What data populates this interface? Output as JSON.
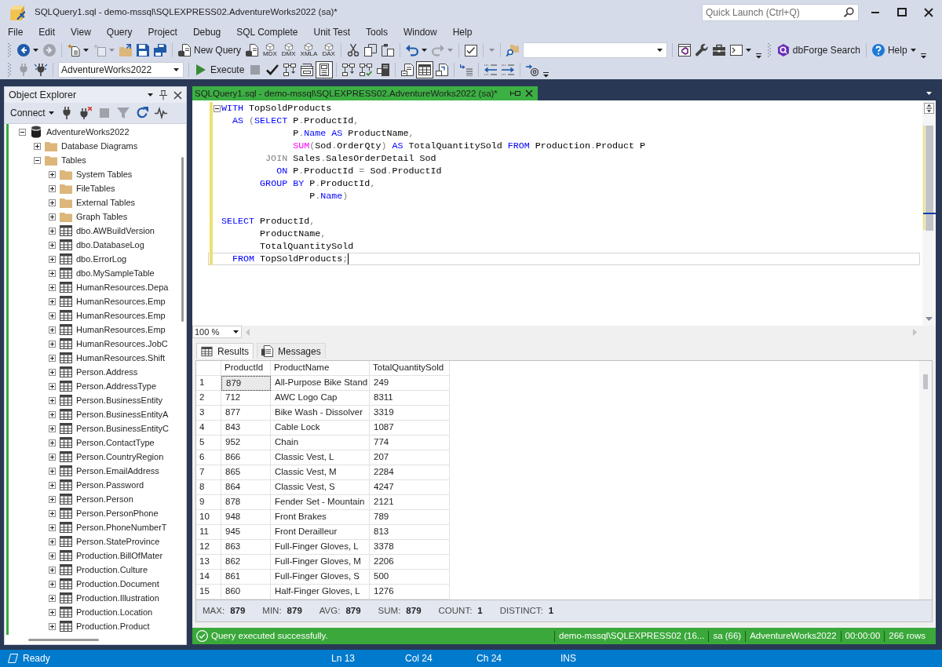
{
  "window": {
    "title": "SQLQuery1.sql - demo-mssql\\SQLEXPRESS02.AdventureWorks2022 (sa)*"
  },
  "quick_launch": {
    "placeholder": "Quick Launch (Ctrl+Q)"
  },
  "menu": [
    "File",
    "Edit",
    "View",
    "Query",
    "Project",
    "Debug",
    "SQL Complete",
    "Unit Test",
    "Tools",
    "Window",
    "Help"
  ],
  "standard_toolbar": {
    "buttons": [
      {
        "disabled": false
      },
      {
        "disabled": true
      },
      {
        "disabled": false
      },
      {
        "disabled": true
      },
      {
        "disabled": false
      },
      {
        "disabled": false
      },
      {
        "disabled": false
      },
      {
        "label": "New Query",
        "disabled": false
      },
      {
        "disabled": false
      },
      {
        "caption": "MDX",
        "disabled": false
      },
      {
        "caption": "DMX",
        "disabled": false
      },
      {
        "caption": "XMLA",
        "disabled": false
      },
      {
        "caption": "DAX",
        "disabled": false
      },
      {
        "disabled": false
      },
      {
        "disabled": false
      },
      {
        "disabled": false
      },
      {
        "disabled": false
      },
      {
        "disabled": true
      },
      {
        "disabled": false
      },
      {
        "disabled": true
      },
      {
        "disabled": false
      },
      {
        "disabled": false
      },
      {
        "disabled": false
      },
      {
        "disabled": false
      },
      {
        "disabled": false
      },
      {
        "label": "dbForge Search",
        "disabled": false
      },
      {
        "label": "Help",
        "disabled": false
      }
    ]
  },
  "sql_toolbar": {
    "database": "AdventureWorks2022",
    "buttons": [
      {
        "disabled": true
      },
      {
        "disabled": false
      },
      {
        "label": "Execute",
        "disabled": false
      },
      {
        "disabled": true
      },
      {
        "disabled": false
      },
      {
        "disabled": false
      },
      {
        "disabled": false
      },
      {
        "disabled": false,
        "on": true
      },
      {
        "disabled": false
      },
      {
        "disabled": false
      },
      {
        "disabled": false
      },
      {
        "disabled": false,
        "on": false
      },
      {
        "disabled": false,
        "on": true
      },
      {
        "disabled": false,
        "on": false
      },
      {
        "disabled": false
      },
      {
        "disabled": false
      },
      {
        "disabled": false
      },
      {
        "disabled": false
      }
    ]
  },
  "object_explorer": {
    "title": "Object Explorer",
    "toolbar": [
      {
        "label": "Connect",
        "disabled": false
      },
      {
        "disabled": false
      },
      {
        "disabled": false
      },
      {
        "disabled": true
      },
      {
        "disabled": true
      },
      {
        "disabled": false
      },
      {
        "disabled": false
      }
    ],
    "tree": [
      {
        "label": "AdventureWorks2022",
        "kind": "database",
        "expanded": true,
        "children": [
          {
            "label": "Database Diagrams",
            "kind": "folder",
            "expanded": false
          },
          {
            "label": "Tables",
            "kind": "folder",
            "expanded": true,
            "children": [
              {
                "label": "System Tables",
                "kind": "folder",
                "expanded": false
              },
              {
                "label": "FileTables",
                "kind": "folder",
                "expanded": false
              },
              {
                "label": "External Tables",
                "kind": "folder",
                "expanded": false
              },
              {
                "label": "Graph Tables",
                "kind": "folder",
                "expanded": false
              },
              {
                "label": "dbo.AWBuildVersion",
                "kind": "table",
                "expanded": false
              },
              {
                "label": "dbo.DatabaseLog",
                "kind": "table",
                "expanded": false
              },
              {
                "label": "dbo.ErrorLog",
                "kind": "table",
                "expanded": false
              },
              {
                "label": "dbo.MySampleTable",
                "kind": "table",
                "expanded": false
              },
              {
                "label": "HumanResources.Depa",
                "kind": "table",
                "expanded": false
              },
              {
                "label": "HumanResources.Emp",
                "kind": "table",
                "expanded": false
              },
              {
                "label": "HumanResources.Emp",
                "kind": "table",
                "expanded": false
              },
              {
                "label": "HumanResources.Emp",
                "kind": "table",
                "expanded": false
              },
              {
                "label": "HumanResources.JobC",
                "kind": "table",
                "expanded": false
              },
              {
                "label": "HumanResources.Shift",
                "kind": "table",
                "expanded": false
              },
              {
                "label": "Person.Address",
                "kind": "table",
                "expanded": false
              },
              {
                "label": "Person.AddressType",
                "kind": "table",
                "expanded": false
              },
              {
                "label": "Person.BusinessEntity",
                "kind": "table",
                "expanded": false
              },
              {
                "label": "Person.BusinessEntityA",
                "kind": "table",
                "expanded": false
              },
              {
                "label": "Person.BusinessEntityC",
                "kind": "table",
                "expanded": false
              },
              {
                "label": "Person.ContactType",
                "kind": "table",
                "expanded": false
              },
              {
                "label": "Person.CountryRegion",
                "kind": "table",
                "expanded": false
              },
              {
                "label": "Person.EmailAddress",
                "kind": "table",
                "expanded": false
              },
              {
                "label": "Person.Password",
                "kind": "table",
                "expanded": false
              },
              {
                "label": "Person.Person",
                "kind": "table",
                "expanded": false
              },
              {
                "label": "Person.PersonPhone",
                "kind": "table",
                "expanded": false
              },
              {
                "label": "Person.PhoneNumberT",
                "kind": "table",
                "expanded": false
              },
              {
                "label": "Person.StateProvince",
                "kind": "table",
                "expanded": false
              },
              {
                "label": "Production.BillOfMater",
                "kind": "table",
                "expanded": false
              },
              {
                "label": "Production.Culture",
                "kind": "table",
                "expanded": false
              },
              {
                "label": "Production.Document",
                "kind": "table",
                "expanded": false
              },
              {
                "label": "Production.Illustration",
                "kind": "table",
                "expanded": false
              },
              {
                "label": "Production.Location",
                "kind": "table",
                "expanded": false
              },
              {
                "label": "Production.Product",
                "kind": "table",
                "expanded": false
              }
            ]
          }
        ]
      }
    ]
  },
  "document_tab": {
    "title": "SQLQuery1.sql - demo-mssql\\SQLEXPRESS02.AdventureWorks2022 (sa)*"
  },
  "editor": {
    "lines": [
      {
        "kind": "code",
        "expanded": true,
        "changed": true,
        "current": false,
        "tokens": [
          {
            "kind": "keyword",
            "text": "WITH"
          },
          {
            "kind": "plain",
            "text": " TopSoldProducts"
          }
        ]
      },
      {
        "kind": "code",
        "changed": true,
        "current": false,
        "tokens": [
          {
            "kind": "keyword",
            "text": "  AS"
          },
          {
            "kind": "operator",
            "text": " ("
          },
          {
            "kind": "keyword",
            "text": "SELECT"
          },
          {
            "kind": "plain",
            "text": " P"
          },
          {
            "kind": "operator",
            "text": "."
          },
          {
            "kind": "plain",
            "text": "ProductId"
          },
          {
            "kind": "operator",
            "text": ","
          }
        ]
      },
      {
        "kind": "code",
        "changed": true,
        "current": false,
        "tokens": [
          {
            "kind": "plain",
            "text": "             P"
          },
          {
            "kind": "operator",
            "text": "."
          },
          {
            "kind": "keyword",
            "text": "Name AS"
          },
          {
            "kind": "plain",
            "text": " ProductName"
          },
          {
            "kind": "operator",
            "text": ","
          }
        ]
      },
      {
        "kind": "code",
        "changed": true,
        "current": false,
        "tokens": [
          {
            "kind": "function",
            "text": "             SUM"
          },
          {
            "kind": "operator",
            "text": "("
          },
          {
            "kind": "plain",
            "text": "Sod"
          },
          {
            "kind": "operator",
            "text": "."
          },
          {
            "kind": "plain",
            "text": "OrderQty"
          },
          {
            "kind": "operator",
            "text": ")"
          },
          {
            "kind": "keyword",
            "text": " AS"
          },
          {
            "kind": "plain",
            "text": " TotalQuantitySold "
          },
          {
            "kind": "keyword",
            "text": "FROM"
          },
          {
            "kind": "plain",
            "text": " Production"
          },
          {
            "kind": "operator",
            "text": "."
          },
          {
            "kind": "plain",
            "text": "Product P"
          }
        ]
      },
      {
        "kind": "code",
        "changed": true,
        "current": false,
        "tokens": [
          {
            "kind": "operator",
            "text": "        JOIN"
          },
          {
            "kind": "plain",
            "text": " Sales"
          },
          {
            "kind": "operator",
            "text": "."
          },
          {
            "kind": "plain",
            "text": "SalesOrderDetail Sod"
          }
        ]
      },
      {
        "kind": "code",
        "changed": true,
        "current": false,
        "tokens": [
          {
            "kind": "keyword",
            "text": "          ON"
          },
          {
            "kind": "plain",
            "text": " P"
          },
          {
            "kind": "operator",
            "text": "."
          },
          {
            "kind": "plain",
            "text": "ProductId "
          },
          {
            "kind": "operator",
            "text": "="
          },
          {
            "kind": "plain",
            "text": " Sod"
          },
          {
            "kind": "operator",
            "text": "."
          },
          {
            "kind": "plain",
            "text": "ProductId"
          }
        ]
      },
      {
        "kind": "code",
        "changed": true,
        "current": false,
        "tokens": [
          {
            "kind": "keyword",
            "text": "       GROUP BY"
          },
          {
            "kind": "plain",
            "text": " P"
          },
          {
            "kind": "operator",
            "text": "."
          },
          {
            "kind": "plain",
            "text": "ProductId"
          },
          {
            "kind": "operator",
            "text": ","
          }
        ]
      },
      {
        "kind": "code",
        "changed": true,
        "current": false,
        "tokens": [
          {
            "kind": "plain",
            "text": "                P"
          },
          {
            "kind": "operator",
            "text": "."
          },
          {
            "kind": "keyword",
            "text": "Name"
          },
          {
            "kind": "operator",
            "text": ")"
          }
        ]
      },
      {
        "kind": "blank",
        "changed": true,
        "current": false
      },
      {
        "kind": "code",
        "changed": true,
        "current": false,
        "tokens": [
          {
            "kind": "keyword",
            "text": "SELECT"
          },
          {
            "kind": "plain",
            "text": " ProductId"
          },
          {
            "kind": "operator",
            "text": ","
          }
        ]
      },
      {
        "kind": "code",
        "changed": true,
        "current": false,
        "tokens": [
          {
            "kind": "plain",
            "text": "       ProductName"
          },
          {
            "kind": "operator",
            "text": ","
          }
        ]
      },
      {
        "kind": "code",
        "changed": true,
        "current": false,
        "tokens": [
          {
            "kind": "plain",
            "text": "       TotalQuantitySold"
          }
        ]
      },
      {
        "kind": "code",
        "changed": true,
        "current": true,
        "tokens": [
          {
            "kind": "keyword",
            "text": "  FROM"
          },
          {
            "kind": "plain",
            "text": " TopSoldProducts"
          },
          {
            "kind": "operator",
            "text": ";"
          }
        ]
      }
    ],
    "zoom": "100 %"
  },
  "results": {
    "tabs": [
      {
        "label": "Results",
        "selected": true
      },
      {
        "label": "Messages",
        "selected": false
      }
    ],
    "columns": [
      "ProductId",
      "ProductName",
      "TotalQuantitySold"
    ],
    "rows": [
      {
        "number": "1",
        "cells": [
          {
            "text": "879",
            "selected": true
          },
          {
            "text": "All-Purpose Bike Stand",
            "selected": false
          },
          {
            "text": "249",
            "selected": false
          }
        ]
      },
      {
        "number": "2",
        "cells": [
          {
            "text": "712",
            "selected": false
          },
          {
            "text": "AWC Logo Cap",
            "selected": false
          },
          {
            "text": "8311",
            "selected": false
          }
        ]
      },
      {
        "number": "3",
        "cells": [
          {
            "text": "877",
            "selected": false
          },
          {
            "text": "Bike Wash - Dissolver",
            "selected": false
          },
          {
            "text": "3319",
            "selected": false
          }
        ]
      },
      {
        "number": "4",
        "cells": [
          {
            "text": "843",
            "selected": false
          },
          {
            "text": "Cable Lock",
            "selected": false
          },
          {
            "text": "1087",
            "selected": false
          }
        ]
      },
      {
        "number": "5",
        "cells": [
          {
            "text": "952",
            "selected": false
          },
          {
            "text": "Chain",
            "selected": false
          },
          {
            "text": "774",
            "selected": false
          }
        ]
      },
      {
        "number": "6",
        "cells": [
          {
            "text": "866",
            "selected": false
          },
          {
            "text": "Classic Vest, L",
            "selected": false
          },
          {
            "text": "207",
            "selected": false
          }
        ]
      },
      {
        "number": "7",
        "cells": [
          {
            "text": "865",
            "selected": false
          },
          {
            "text": "Classic Vest, M",
            "selected": false
          },
          {
            "text": "2284",
            "selected": false
          }
        ]
      },
      {
        "number": "8",
        "cells": [
          {
            "text": "864",
            "selected": false
          },
          {
            "text": "Classic Vest, S",
            "selected": false
          },
          {
            "text": "4247",
            "selected": false
          }
        ]
      },
      {
        "number": "9",
        "cells": [
          {
            "text": "878",
            "selected": false
          },
          {
            "text": "Fender Set - Mountain",
            "selected": false
          },
          {
            "text": "2121",
            "selected": false
          }
        ]
      },
      {
        "number": "10",
        "cells": [
          {
            "text": "948",
            "selected": false
          },
          {
            "text": "Front Brakes",
            "selected": false
          },
          {
            "text": "789",
            "selected": false
          }
        ]
      },
      {
        "number": "11",
        "cells": [
          {
            "text": "945",
            "selected": false
          },
          {
            "text": "Front Derailleur",
            "selected": false
          },
          {
            "text": "813",
            "selected": false
          }
        ]
      },
      {
        "number": "12",
        "cells": [
          {
            "text": "863",
            "selected": false
          },
          {
            "text": "Full-Finger Gloves, L",
            "selected": false
          },
          {
            "text": "3378",
            "selected": false
          }
        ]
      },
      {
        "number": "13",
        "cells": [
          {
            "text": "862",
            "selected": false
          },
          {
            "text": "Full-Finger Gloves, M",
            "selected": false
          },
          {
            "text": "2206",
            "selected": false
          }
        ]
      },
      {
        "number": "14",
        "cells": [
          {
            "text": "861",
            "selected": false
          },
          {
            "text": "Full-Finger Gloves, S",
            "selected": false
          },
          {
            "text": "500",
            "selected": false
          }
        ]
      },
      {
        "number": "15",
        "cells": [
          {
            "text": "860",
            "selected": false
          },
          {
            "text": "Half-Finger Gloves, L",
            "selected": false
          },
          {
            "text": "1276",
            "selected": false
          }
        ]
      }
    ],
    "aggregates": [
      {
        "label": "MAX:",
        "value": "879"
      },
      {
        "label": "MIN:",
        "value": "879"
      },
      {
        "label": "AVG:",
        "value": "879"
      },
      {
        "label": "SUM:",
        "value": "879"
      },
      {
        "label": "COUNT:",
        "value": "1"
      },
      {
        "label": "DISTINCT:",
        "value": "1"
      }
    ]
  },
  "query_status": {
    "message": "Query executed successfully.",
    "details": [
      "demo-mssql\\SQLEXPRESS02 (16...",
      "sa (66)",
      "AdventureWorks2022",
      "00:00:00",
      "266 rows"
    ]
  },
  "status_bar": {
    "state": "Ready",
    "items": [
      "Ln 13",
      "Col 24",
      "Ch 24",
      "INS"
    ]
  }
}
